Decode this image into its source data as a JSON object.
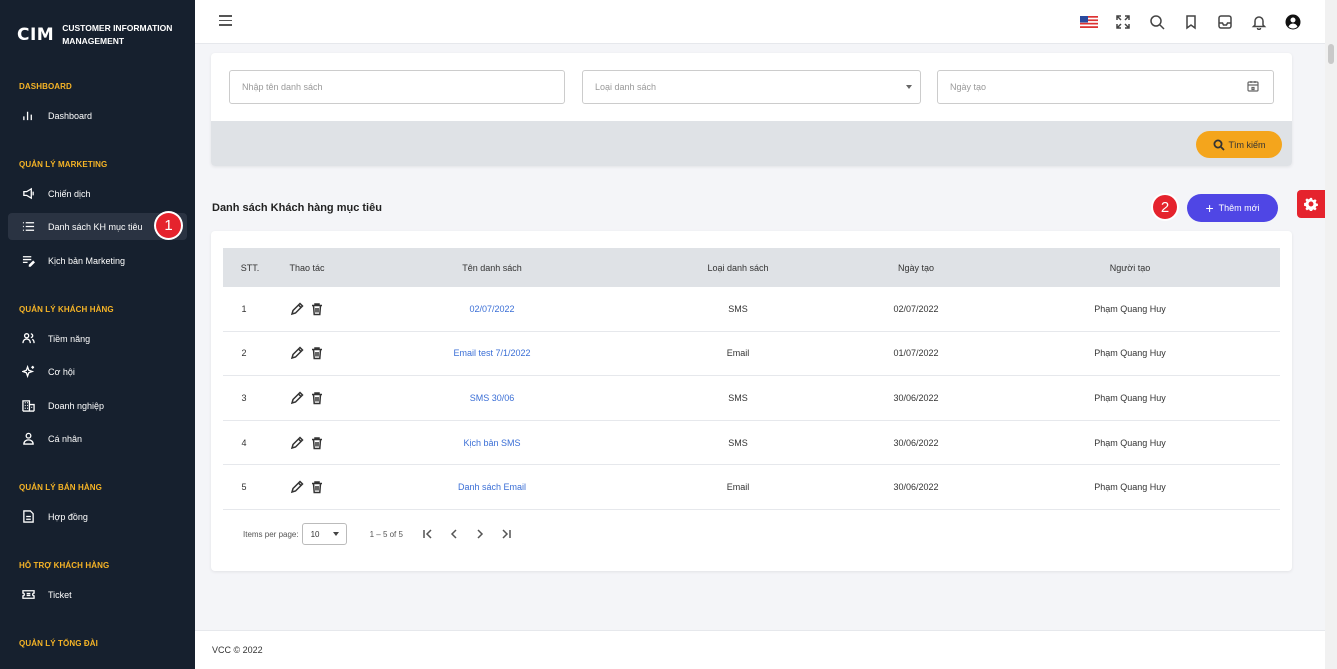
{
  "brand": {
    "logo": "CIM",
    "name": "CUSTOMER INFORMATION MANAGEMENT"
  },
  "sidebar": {
    "sections": [
      {
        "title": "DASHBOARD"
      },
      {
        "title": "QUẢN LÝ MARKETING"
      },
      {
        "title": "QUẢN LÝ KHÁCH HÀNG"
      },
      {
        "title": "QUẢN LÝ BÁN HÀNG"
      },
      {
        "title": "HỖ TRỢ KHÁCH HÀNG"
      },
      {
        "title": "QUẢN LÝ TỔNG ĐÀI"
      }
    ],
    "items": [
      {
        "label": "Dashboard",
        "icon": "bar-chart-icon"
      },
      {
        "label": "Chiến dịch",
        "icon": "megaphone-icon"
      },
      {
        "label": "Danh sách KH mục tiêu",
        "icon": "list-icon",
        "active": true
      },
      {
        "label": "Kịch bản Marketing",
        "icon": "script-icon"
      },
      {
        "label": "Tiềm năng",
        "icon": "people-icon"
      },
      {
        "label": "Cơ hội",
        "icon": "sparkle-icon"
      },
      {
        "label": "Doanh nghiệp",
        "icon": "building-icon"
      },
      {
        "label": "Cá nhân",
        "icon": "person-icon"
      },
      {
        "label": "Hợp đồng",
        "icon": "document-icon"
      },
      {
        "label": "Ticket",
        "icon": "ticket-icon"
      }
    ]
  },
  "annotations": {
    "badge1": "1",
    "badge2": "2"
  },
  "topbar": {
    "icons": [
      "us-flag-icon",
      "fullscreen-icon",
      "search-icon",
      "bookmark-icon",
      "inbox-icon",
      "bell-icon",
      "user-circle-icon"
    ]
  },
  "filter": {
    "name_placeholder": "Nhập tên danh sách",
    "type_placeholder": "Loại danh sách",
    "date_placeholder": "Ngày tạo",
    "search_label": "Tìm kiếm"
  },
  "list": {
    "title": "Danh sách Khách hàng mục tiêu",
    "add_label": "Thêm mới",
    "columns": [
      "STT.",
      "Thao tác",
      "Tên danh sách",
      "Loại danh sách",
      "Ngày tạo",
      "Người tạo"
    ],
    "rows": [
      {
        "stt": "1",
        "name": "02/07/2022",
        "type": "SMS",
        "date": "02/07/2022",
        "creator": "Phạm Quang Huy"
      },
      {
        "stt": "2",
        "name": "Email test 7/1/2022",
        "type": "Email",
        "date": "01/07/2022",
        "creator": "Phạm Quang Huy"
      },
      {
        "stt": "3",
        "name": "SMS 30/06",
        "type": "SMS",
        "date": "30/06/2022",
        "creator": "Phạm Quang Huy"
      },
      {
        "stt": "4",
        "name": "Kịch bản SMS",
        "type": "SMS",
        "date": "30/06/2022",
        "creator": "Phạm Quang Huy"
      },
      {
        "stt": "5",
        "name": "Danh sách Email",
        "type": "Email",
        "date": "30/06/2022",
        "creator": "Phạm Quang Huy"
      }
    ]
  },
  "pager": {
    "items_label": "Items per page:",
    "per_page": "10",
    "range": "1 – 5 of 5"
  },
  "footer": {
    "text": "VCC © 2022"
  },
  "colors": {
    "sidebar": "#16202e",
    "accent_section": "#f6b426",
    "primary": "#4f46e5",
    "search": "#f4a51c",
    "badge": "#e5232d"
  }
}
